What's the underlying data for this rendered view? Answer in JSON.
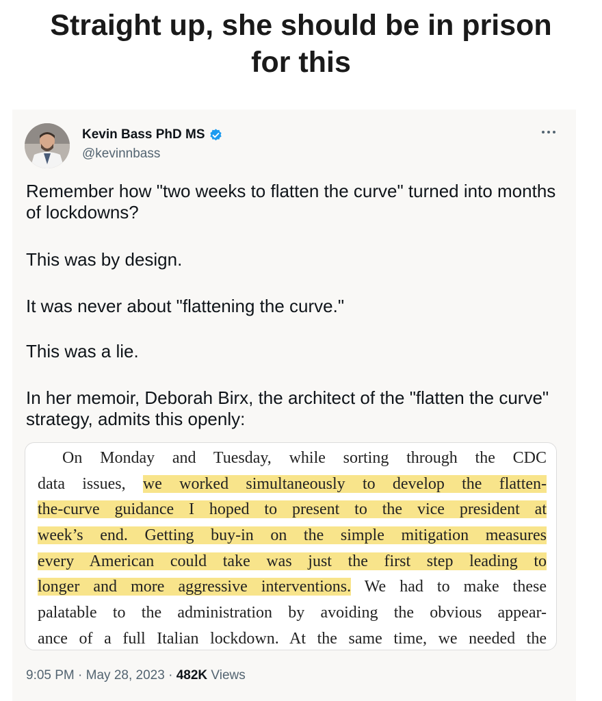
{
  "caption": {
    "line1": "Straight up, she should be in prison",
    "line2": "for this"
  },
  "tweet": {
    "author_name": "Kevin Bass PhD MS",
    "handle": "@kevinnbass",
    "verified_color": "#1d9bf0",
    "more_icon": "more-horizontal-icon",
    "paragraphs": {
      "p1": "Remember how \"two weeks to flatten the curve\" turned into months of lockdowns?",
      "p2": "This was by design.",
      "p3": "It was never about \"flattening the curve.\"",
      "p4": "This was a lie.",
      "p5": "In her memoir, Deborah Birx, the architect of the \"flatten the curve\" strategy, admits this openly:"
    },
    "book_excerpt": {
      "highlight_color": "#f8e48b",
      "l1": "On Monday and Tuesday, while sorting through the CDC",
      "l2a": "data issues, ",
      "l2b": "we worked simultaneously to develop the flatten-",
      "l3": "the-curve guidance I hoped to present to the vice president at",
      "l4": "week’s end. Getting buy-in on the simple mitigation measures",
      "l5": "every American could take was just the first step leading to",
      "l6a": "longer and more aggressive interventions.",
      "l6b": " We had to make these",
      "l7": "palatable to the administration by avoiding the obvious appear-",
      "l8": "ance of a full Italian lockdown. At the same time, we needed the"
    },
    "meta": {
      "time": "9:05 PM",
      "sep1": " · ",
      "date": "May 28, 2023",
      "sep2": " · ",
      "views_count": "482K",
      "views_label": " Views"
    }
  }
}
